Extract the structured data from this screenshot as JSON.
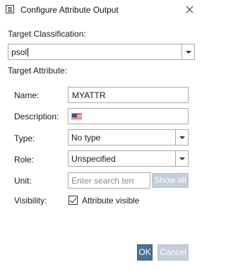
{
  "window": {
    "title": "Configure Attribute Output"
  },
  "target_classification": {
    "label": "Target Classification:",
    "value": "psol"
  },
  "target_attribute": {
    "label": "Target Attribute:"
  },
  "fields": {
    "name": {
      "label": "Name:",
      "value": "MYATTR"
    },
    "description": {
      "label": "Description:",
      "value": "",
      "flag_icon": "us-flag-icon"
    },
    "type": {
      "label": "Type:",
      "value": "No type"
    },
    "role": {
      "label": "Role:",
      "value": "Unspecified"
    },
    "unit": {
      "label": "Unit:",
      "placeholder": "Enter search terr",
      "show_all_label": "Show all"
    },
    "visibility": {
      "label": "Visibility:",
      "checkbox_label": "Attribute visible",
      "checked": true
    }
  },
  "buttons": {
    "ok": "OK",
    "cancel": "Cancel"
  },
  "colors": {
    "ok_bg": "#4d7192",
    "disabled_bg": "#c4ced8",
    "border": "#a9a9a9"
  }
}
